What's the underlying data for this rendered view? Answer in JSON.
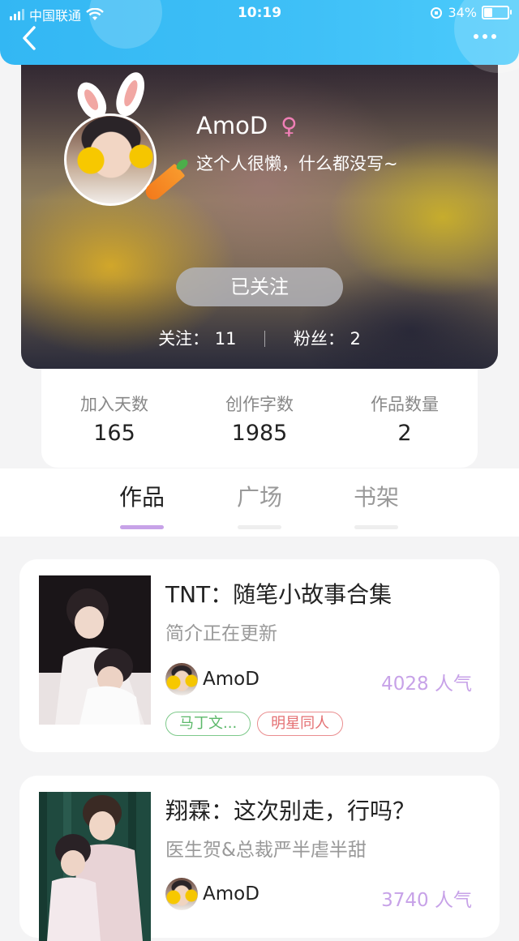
{
  "status_bar": {
    "carrier": "中国联通",
    "time": "10:19",
    "battery": "34%"
  },
  "profile": {
    "name": "AmoD",
    "gender_symbol": "♀",
    "bio": "这个人很懒，什么都没写~",
    "follow_button": "已关注",
    "following_label": "关注：",
    "following_count": "11",
    "fans_label": "粉丝：",
    "fans_count": "2"
  },
  "stats": [
    {
      "label": "加入天数",
      "value": "165"
    },
    {
      "label": "创作字数",
      "value": "1985"
    },
    {
      "label": "作品数量",
      "value": "2"
    }
  ],
  "tabs": [
    {
      "label": "作品",
      "active": true
    },
    {
      "label": "广场",
      "active": false
    },
    {
      "label": "书架",
      "active": false
    }
  ],
  "works": [
    {
      "title": "TNT：随笔小故事合集",
      "desc": "简介正在更新",
      "author": "AmoD",
      "popularity": "4028 人气",
      "tags": [
        {
          "label": "马丁文...",
          "color": "#5cb86a"
        },
        {
          "label": "明星同人",
          "color": "#e46f72"
        }
      ]
    },
    {
      "title": "翔霖：这次别走，行吗？",
      "desc": "医生贺&总裁严半虐半甜",
      "author": "AmoD",
      "popularity": "3740 人气"
    }
  ],
  "colors": {
    "accent": "#c7a2e8",
    "header_blue": "#3fc0f7"
  }
}
